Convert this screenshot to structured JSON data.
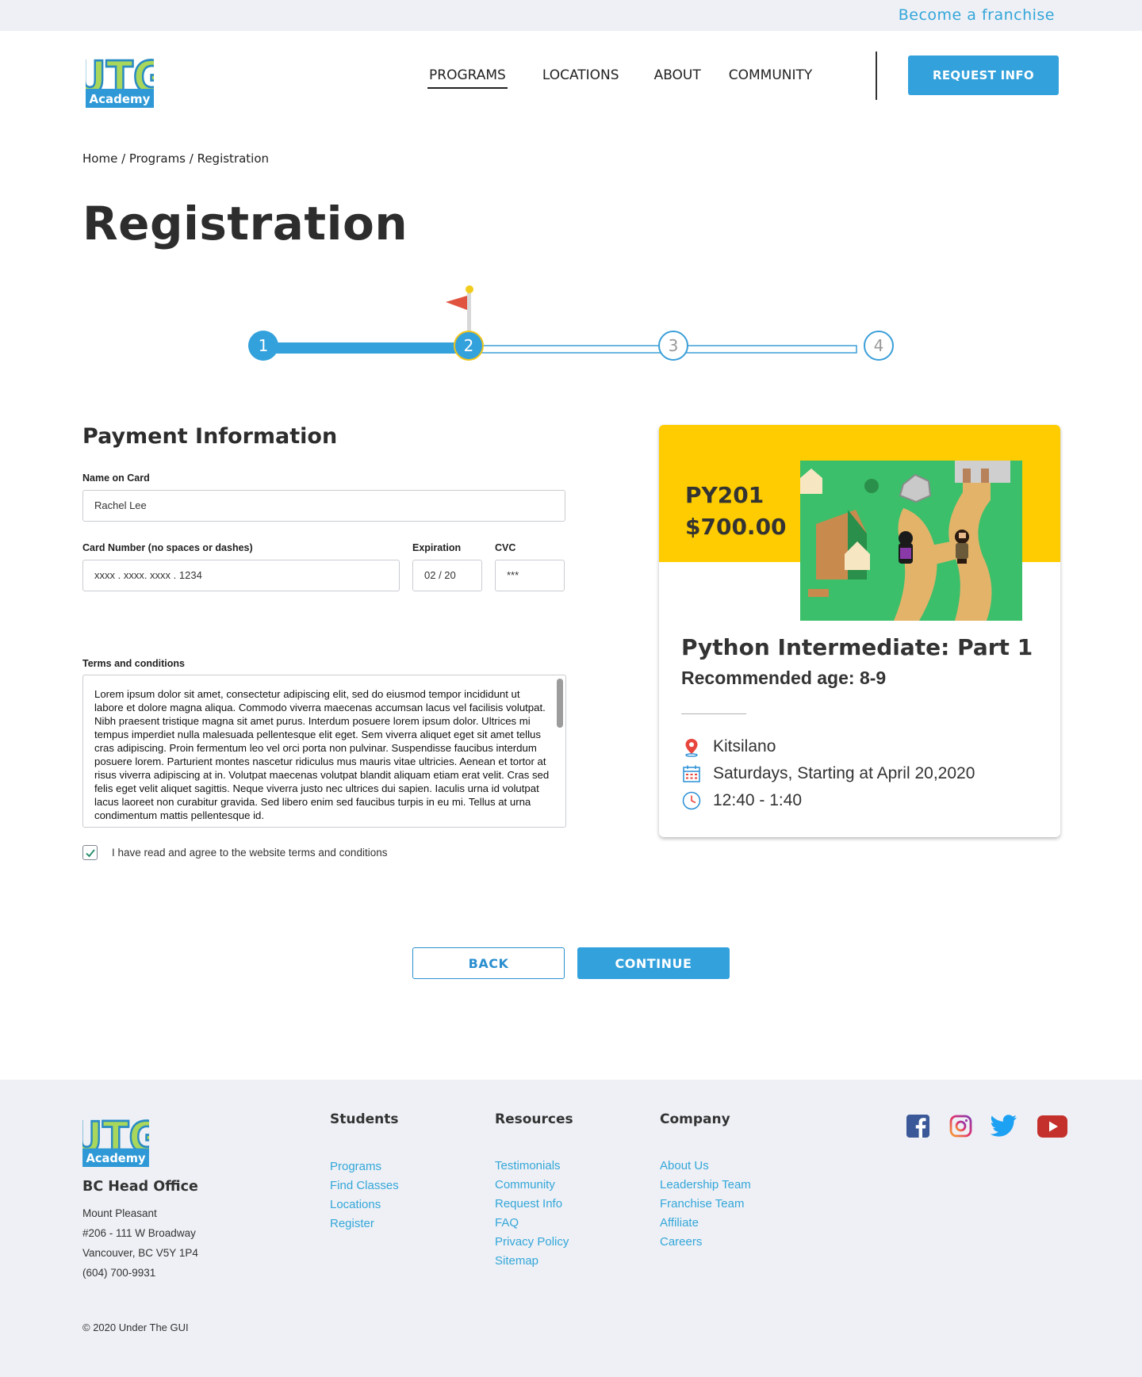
{
  "topbar": {
    "franchise_link": "Become a franchise"
  },
  "brand": {
    "logo_letters": "UTG",
    "logo_sub": "Academy"
  },
  "nav": {
    "items": [
      "PROGRAMS",
      "LOCATIONS",
      "ABOUT",
      "COMMUNITY"
    ],
    "active": "PROGRAMS",
    "cta": "REQUEST INFO"
  },
  "breadcrumb": "Home / Programs / Registration",
  "page_title": "Registration",
  "stepper": {
    "steps": [
      "1",
      "2",
      "3",
      "4"
    ],
    "current_step": 2
  },
  "payment": {
    "title": "Payment Information",
    "name_label": "Name on Card",
    "name_value": "Rachel Lee",
    "card_label": "Card Number (no spaces or dashes)",
    "card_value": "xxxx . xxxx. xxxx . 1234",
    "exp_label": "Expiration",
    "exp_value": "02 / 20",
    "cvc_label": "CVC",
    "cvc_value": "***",
    "terms_label": "Terms and conditions",
    "terms_text": "Lorem ipsum dolor sit amet, consectetur adipiscing elit, sed do eiusmod tempor incididunt ut labore et dolore magna aliqua. Commodo viverra maecenas accumsan lacus vel facilisis volutpat. Nibh praesent tristique magna sit amet purus. Interdum posuere lorem ipsum dolor. Ultrices mi tempus imperdiet nulla malesuada pellentesque elit eget. Sem viverra aliquet eget sit amet tellus cras adipiscing. Proin fermentum leo vel orci porta non pulvinar. Suspendisse faucibus interdum posuere lorem. Parturient montes nascetur ridiculus mus mauris vitae ultricies. Aenean et tortor at risus viverra adipiscing at in. Volutpat maecenas volutpat blandit aliquam etiam erat velit. Cras sed felis eget velit aliquet sagittis. Neque viverra justo nec ultrices dui sapien. Iaculis urna id volutpat lacus laoreet non curabitur gravida. Sed libero enim sed faucibus turpis in eu mi. Tellus at urna condimentum mattis pellentesque id.",
    "agree_label": "I have read and agree to the website terms and conditions",
    "agree_checked": true
  },
  "course": {
    "code": "PY201",
    "price": "$700.00",
    "name": "Python Intermediate: Part 1",
    "age": "Recommended age: 8-9",
    "location": "Kitsilano",
    "schedule": "Saturdays, Starting at April 20,2020",
    "time": "12:40 - 1:40"
  },
  "actions": {
    "back": "BACK",
    "continue": "CONTINUE"
  },
  "footer": {
    "office_title": "BC Head Office",
    "office_lines": [
      "Mount Pleasant",
      "#206 - 111 W Broadway",
      "Vancouver, BC V5Y 1P4",
      "(604) 700-9931"
    ],
    "columns": [
      {
        "title": "Students",
        "links": [
          "Programs",
          "Find Classes",
          "Locations",
          "Register"
        ]
      },
      {
        "title": "Resources",
        "links": [
          "Testimonials",
          "Community",
          "Request Info",
          "FAQ",
          "Privacy Policy",
          "Sitemap"
        ]
      },
      {
        "title": "Company",
        "links": [
          "About Us",
          "Leadership Team",
          "Franchise Team",
          "Affiliate",
          "Careers"
        ]
      }
    ],
    "social_icons": [
      "facebook-icon",
      "instagram-icon",
      "twitter-icon",
      "youtube-icon"
    ],
    "copyright": "© 2020 Under The GUI"
  },
  "colors": {
    "accent": "#33a1dc",
    "link": "#33a6d9",
    "card_band": "#fecc00",
    "flag": "#e0533e"
  }
}
